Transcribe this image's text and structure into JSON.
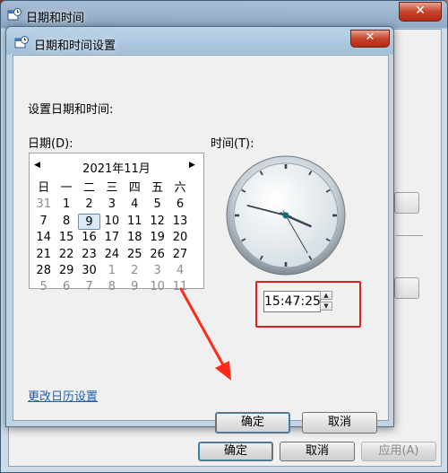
{
  "outer": {
    "title": "日期和时间",
    "ok_label": "确定",
    "cancel_label": "取消",
    "apply_label": "应用(A)"
  },
  "inner": {
    "title": "日期和时间设置",
    "heading": "设置日期和时间:",
    "date_label": "日期(D):",
    "time_label": "时间(T):",
    "calendar": {
      "month_label": "2021年11月",
      "weekdays": [
        "日",
        "一",
        "二",
        "三",
        "四",
        "五",
        "六"
      ],
      "weeks": [
        [
          {
            "d": "31",
            "dim": true
          },
          {
            "d": "1"
          },
          {
            "d": "2"
          },
          {
            "d": "3"
          },
          {
            "d": "4"
          },
          {
            "d": "5"
          },
          {
            "d": "6"
          }
        ],
        [
          {
            "d": "7"
          },
          {
            "d": "8"
          },
          {
            "d": "9",
            "sel": true
          },
          {
            "d": "10"
          },
          {
            "d": "11"
          },
          {
            "d": "12"
          },
          {
            "d": "13"
          }
        ],
        [
          {
            "d": "14"
          },
          {
            "d": "15"
          },
          {
            "d": "16"
          },
          {
            "d": "17"
          },
          {
            "d": "18"
          },
          {
            "d": "19"
          },
          {
            "d": "20"
          }
        ],
        [
          {
            "d": "21"
          },
          {
            "d": "22"
          },
          {
            "d": "23"
          },
          {
            "d": "24"
          },
          {
            "d": "25"
          },
          {
            "d": "26"
          },
          {
            "d": "27"
          }
        ],
        [
          {
            "d": "28"
          },
          {
            "d": "29"
          },
          {
            "d": "30"
          },
          {
            "d": "1",
            "dim": true
          },
          {
            "d": "2",
            "dim": true
          },
          {
            "d": "3",
            "dim": true
          },
          {
            "d": "4",
            "dim": true
          }
        ],
        [
          {
            "d": "5",
            "dim": true
          },
          {
            "d": "6",
            "dim": true
          },
          {
            "d": "7",
            "dim": true
          },
          {
            "d": "8",
            "dim": true
          },
          {
            "d": "9",
            "dim": true
          },
          {
            "d": "10",
            "dim": true
          },
          {
            "d": "11",
            "dim": true
          }
        ]
      ]
    },
    "time_value": "15:47:25",
    "clock_time": {
      "h": 15,
      "m": 47,
      "s": 25
    },
    "change_calendar_link": "更改日历设置",
    "ok_label": "确定",
    "cancel_label": "取消"
  },
  "colors": {
    "highlight": "#e02020",
    "link": "#1a5fb4",
    "arrow": "#ff2a1a"
  }
}
